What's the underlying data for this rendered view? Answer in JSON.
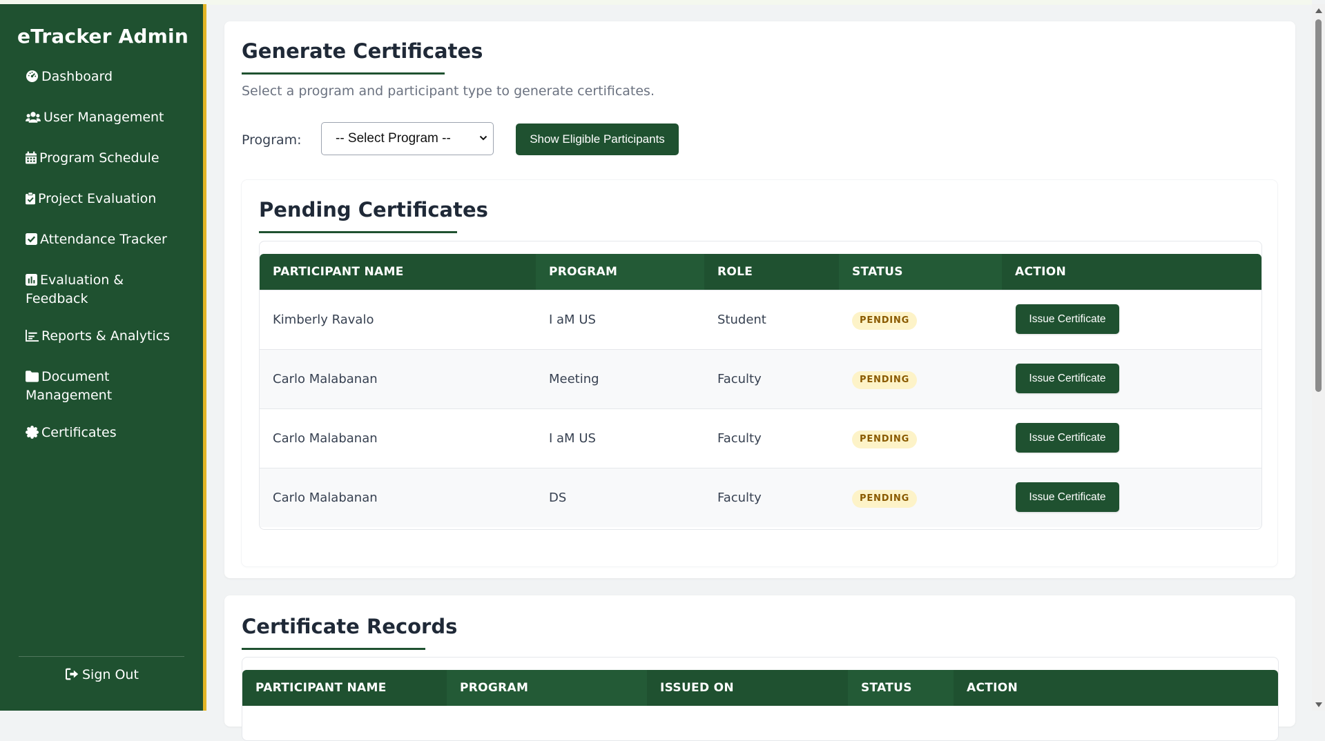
{
  "sidebar": {
    "brand": "eTracker Admin",
    "items": [
      {
        "label": "Dashboard",
        "icon": "dashboard-gauge-icon"
      },
      {
        "label": "User Management",
        "icon": "users-icon"
      },
      {
        "label": "Program Schedule",
        "icon": "calendar-icon"
      },
      {
        "label": "Project Evaluation",
        "icon": "clipboard-check-icon"
      },
      {
        "label": "Attendance Tracker",
        "icon": "check-square-icon"
      },
      {
        "label": "Evaluation &",
        "label2": "Feedback",
        "icon": "poll-chart-icon"
      },
      {
        "label": "Reports & Analytics",
        "icon": "line-chart-icon"
      },
      {
        "label": "Document",
        "label2": "Management",
        "icon": "folder-icon"
      },
      {
        "label": "Certificates",
        "icon": "certificate-icon"
      }
    ],
    "sign_out": "Sign Out"
  },
  "generate": {
    "title": "Generate Certificates",
    "subtitle": "Select a program and participant type to generate certificates.",
    "program_label": "Program:",
    "program_select_value": "-- Select Program --",
    "show_button": "Show Eligible Participants"
  },
  "pending": {
    "title": "Pending Certificates",
    "columns": [
      "PARTICIPANT NAME",
      "PROGRAM",
      "ROLE",
      "STATUS",
      "ACTION"
    ],
    "rows": [
      {
        "name": "Kimberly Ravalo",
        "program": "I aM US",
        "role": "Student",
        "status": "PENDING",
        "action": "Issue Certificate"
      },
      {
        "name": "Carlo Malabanan",
        "program": "Meeting",
        "role": "Faculty",
        "status": "PENDING",
        "action": "Issue Certificate"
      },
      {
        "name": "Carlo Malabanan",
        "program": "I aM US",
        "role": "Faculty",
        "status": "PENDING",
        "action": "Issue Certificate"
      },
      {
        "name": "Carlo Malabanan",
        "program": "DS",
        "role": "Faculty",
        "status": "PENDING",
        "action": "Issue Certificate"
      }
    ]
  },
  "records": {
    "title": "Certificate Records",
    "columns": [
      "PARTICIPANT NAME",
      "PROGRAM",
      "ISSUED ON",
      "STATUS",
      "ACTION"
    ]
  },
  "colors": {
    "primary": "#1f5130",
    "accent": "#e3b526",
    "badge_bg": "#fdf3c8",
    "badge_text": "#8a5a00"
  }
}
